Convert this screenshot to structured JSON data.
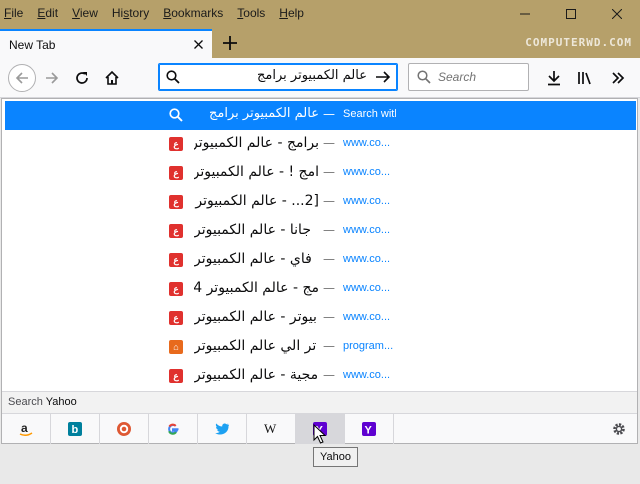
{
  "menu": [
    {
      "acc": "F",
      "rest": "ile"
    },
    {
      "acc": "E",
      "rest": "dit"
    },
    {
      "acc": "V",
      "rest": "iew"
    },
    {
      "acc": "",
      "rest": "History",
      "underline_idx": 0
    },
    {
      "acc": "B",
      "rest": "ookmarks"
    },
    {
      "acc": "T",
      "rest": "ools"
    },
    {
      "acc": "H",
      "rest": "elp"
    }
  ],
  "tab": {
    "label": "New Tab"
  },
  "watermark": "COMPUTERWD.COM",
  "urlbar": {
    "value": "عالم الكمبيوتر برامج"
  },
  "searchbar": {
    "placeholder": "Search"
  },
  "selected_result": {
    "title": "عالم الكمبيوتر برامج",
    "dash": "—",
    "action": "Search with Google"
  },
  "results": [
    {
      "title": "برامج - عالم الكمبيوتر",
      "url": "www.co...",
      "icon": "ع"
    },
    {
      "title": "امج ! - عالم الكمبيوتر",
      "url": "www.co...",
      "icon": "ع"
    },
    {
      "title": "[2... - عالم الكمبيوتر 5",
      "url": "www.co...",
      "icon": "ع"
    },
    {
      "title": "جانا - عالم الكمبيوتر",
      "url": "www.co...",
      "icon": "ع"
    },
    {
      "title": "فاي - عالم الكمبيوتر",
      "url": "www.co...",
      "icon": "ع"
    },
    {
      "title": "مج - عالم الكمبيوتر 4",
      "url": "www.co...",
      "icon": "ع"
    },
    {
      "title": "بيوتر - عالم الكمبيوتر",
      "url": "www.co...",
      "icon": "ع"
    },
    {
      "title": "تر الي عالم الكمبيوتر",
      "url": "program...",
      "icon": "⌂",
      "home": true
    },
    {
      "title": "مجية - عالم الكمبيوتر",
      "url": "www.co...",
      "icon": "ع"
    }
  ],
  "separator": "—",
  "search_header": {
    "prefix": "Search ",
    "engine": "Yahoo"
  },
  "engines": [
    "Amazon",
    "Bing",
    "DuckDuckGo",
    "Google",
    "Twitter",
    "Wikipedia",
    "Yahoo (hovered)",
    "Yahoo"
  ],
  "tooltip": "Yahoo",
  "colors": {
    "accent": "#0a84ff",
    "titlebar": "#b6a06a"
  }
}
